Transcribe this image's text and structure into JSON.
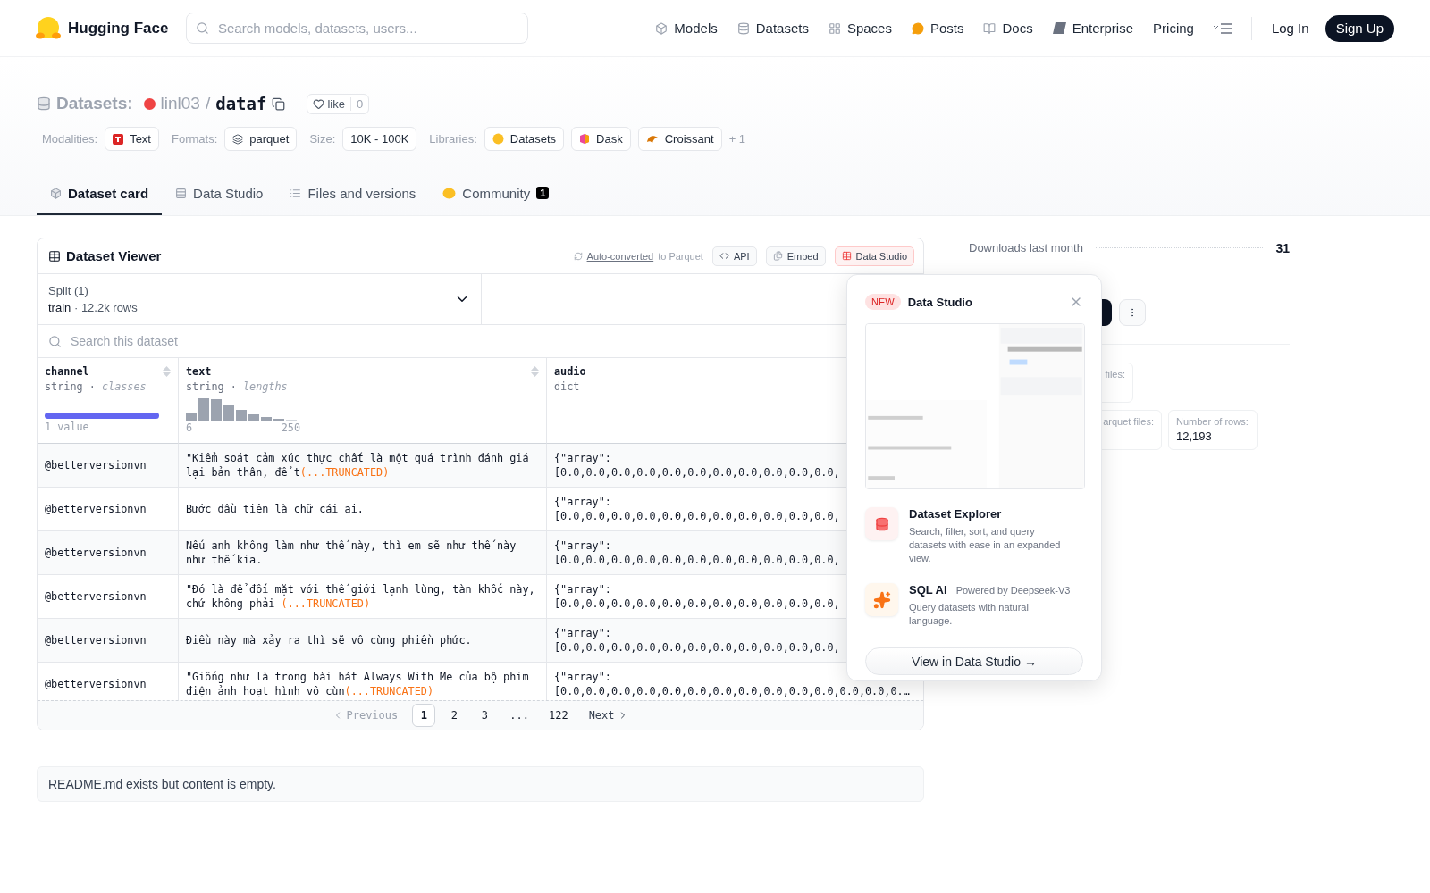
{
  "header": {
    "brand": "Hugging Face",
    "search": {
      "placeholder": "Search models, datasets, users..."
    },
    "nav": [
      {
        "label": "Models",
        "kind": "models"
      },
      {
        "label": "Datasets",
        "kind": "datasets"
      },
      {
        "label": "Spaces",
        "kind": "spaces"
      },
      {
        "label": "Posts",
        "kind": "posts"
      },
      {
        "label": "Docs",
        "kind": "docs"
      },
      {
        "label": "Enterprise",
        "kind": "enterprise"
      },
      {
        "label": "Pricing",
        "kind": "plain"
      }
    ],
    "login": "Log In",
    "signup": "Sign Up"
  },
  "dataset": {
    "category": "Datasets:",
    "owner": "linl03",
    "separator": "/",
    "name": "dataf",
    "like": {
      "label": "like",
      "count": "0"
    }
  },
  "tag_groups": [
    {
      "label": "Modalities:",
      "items": [
        {
          "text": "Text",
          "kind": "text"
        }
      ]
    },
    {
      "label": "Formats:",
      "items": [
        {
          "text": "parquet",
          "kind": "parquet"
        }
      ]
    },
    {
      "label": "Size:",
      "items": [
        {
          "text": "10K - 100K",
          "kind": "plain"
        }
      ]
    },
    {
      "label": "Libraries:",
      "items": [
        {
          "text": "Datasets",
          "kind": "datasets"
        },
        {
          "text": "Dask",
          "kind": "dask"
        },
        {
          "text": "Croissant",
          "kind": "croissant"
        }
      ],
      "more": "+ 1"
    }
  ],
  "tabs": [
    {
      "label": "Dataset card",
      "kind": "card",
      "selected": true
    },
    {
      "label": "Data Studio",
      "kind": "studio",
      "selected": false
    },
    {
      "label": "Files and versions",
      "kind": "files",
      "selected": false
    },
    {
      "label": "Community",
      "kind": "community",
      "selected": false,
      "badge": "1"
    }
  ],
  "viewer": {
    "title": "Dataset Viewer",
    "converted_link": "Auto-converted",
    "converted_text": "to Parquet",
    "buttons": [
      {
        "label": "API",
        "kind": "api"
      },
      {
        "label": "Embed",
        "kind": "embed"
      },
      {
        "label": "Data Studio",
        "kind": "studio"
      }
    ],
    "split": {
      "label": "Split (1)",
      "name": "train",
      "dot": "·",
      "rows": "12.2k rows"
    },
    "search": {
      "placeholder": "Search this dataset"
    },
    "columns": [
      {
        "name": "channel",
        "type": "string",
        "dot": "·",
        "stat": "classes",
        "kind": "classes",
        "caption": "1 value"
      },
      {
        "name": "text",
        "type": "string",
        "dot": "·",
        "stat": "lengths",
        "kind": "histogram",
        "min": "6",
        "max": "250"
      },
      {
        "name": "audio",
        "type": "dict",
        "kind": "plain"
      }
    ],
    "rows": [
      {
        "channel": "@betterversionvn",
        "text": "\"Kiểm soát cảm xúc thực chất là một quá trình đánh giá lại bản thân, để t",
        "truncated": "(...TRUNCATED)",
        "audio": [
          "{\"array\":",
          "[0.0,0.0,0.0,0.0,0.0,0.0,0.0,0.0,0.0,0.0,0.0,"
        ]
      },
      {
        "channel": "@betterversionvn",
        "text": "Bước đầu tiên là chữ cái ai.",
        "audio": [
          "{\"array\":",
          "[0.0,0.0,0.0,0.0,0.0,0.0,0.0,0.0,0.0,0.0,0.0,"
        ]
      },
      {
        "channel": "@betterversionvn",
        "text": "Nếu anh không làm như thế này, thì em sẽ như thế này như thế kia.",
        "audio": [
          "{\"array\":",
          "[0.0,0.0,0.0,0.0,0.0,0.0,0.0,0.0,0.0,0.0,0.0,"
        ]
      },
      {
        "channel": "@betterversionvn",
        "text": "\"Đó là để đối mặt với thế giới lạnh lùng, tàn khốc này, chứ không phải ",
        "truncated": "(...TRUNCATED)",
        "audio": [
          "{\"array\":",
          "[0.0,0.0,0.0,0.0,0.0,0.0,0.0,0.0,0.0,0.0,0.0,"
        ]
      },
      {
        "channel": "@betterversionvn",
        "text": "Điều này mà xảy ra thì sẽ vô cùng phiền phức.",
        "audio": [
          "{\"array\":",
          "[0.0,0.0,0.0,0.0,0.0,0.0,0.0,0.0,0.0,0.0,0.0,"
        ]
      },
      {
        "channel": "@betterversionvn",
        "text": "\"Giống như là trong bài hát Always With Me của bộ phim điện ảnh hoạt hình vô cùn",
        "truncated": "(...TRUNCATED)",
        "audio": [
          "{\"array\":",
          "[0.0,0.0,0.0,0.0,0.0,0.0,0.0,0.0,0.0,0.0,0.0,0.0,0.0,0.…"
        ]
      }
    ],
    "pagination": {
      "previous": "Previous",
      "pages": [
        {
          "label": "1",
          "selected": true
        },
        {
          "label": "2",
          "selected": false
        },
        {
          "label": "3",
          "selected": false
        },
        {
          "label": "...",
          "selected": false
        },
        {
          "label": "122",
          "selected": false
        }
      ],
      "next": "Next"
    }
  },
  "readme": "README.md exists but content is empty.",
  "sidebar": {
    "downloads_label": "Downloads last month",
    "downloads": "31",
    "stats": [
      {
        "label": "files:"
      },
      {
        "label": "arquet files:"
      },
      {
        "label": "Number of rows:",
        "value": "12,193"
      }
    ]
  },
  "popup": {
    "badge": "NEW",
    "title": "Data Studio",
    "features": [
      {
        "kind": "explorer",
        "title": "Dataset Explorer",
        "description": "Search, filter, sort, and query datasets with ease in an expanded view."
      },
      {
        "kind": "sql",
        "title": "SQL AI",
        "note": "Powered by Deepseek-V3",
        "description": "Query datasets with natural language."
      }
    ],
    "button": "View in Data Studio →"
  }
}
